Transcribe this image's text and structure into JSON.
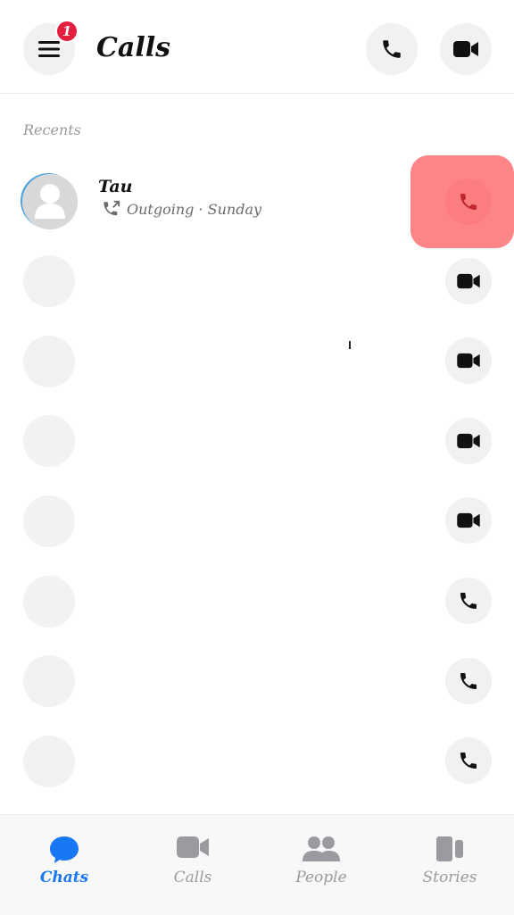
{
  "header": {
    "title": "Calls",
    "menu_badge": "1"
  },
  "recents": {
    "label": "Recents",
    "first_call": {
      "name": "Tau",
      "detail": "Outgoing · Sunday"
    },
    "rows": [
      {
        "action": "video-icon"
      },
      {
        "action": "video-icon"
      },
      {
        "action": "video-icon"
      },
      {
        "action": "video-icon"
      },
      {
        "action": "phone-icon"
      },
      {
        "action": "phone-icon"
      },
      {
        "action": "phone-icon"
      }
    ]
  },
  "tabs": [
    {
      "label": "Chats",
      "icon": "chat-bubble-icon",
      "active": true
    },
    {
      "label": "Calls",
      "icon": "video-camera-icon",
      "active": false
    },
    {
      "label": "People",
      "icon": "people-icon",
      "active": false
    },
    {
      "label": "Stories",
      "icon": "stories-icon",
      "active": false
    }
  ],
  "colors": {
    "accent": "#1877f2",
    "badge": "#e41e3f",
    "highlight": "#fe8587",
    "call_red": "#e0303a"
  }
}
